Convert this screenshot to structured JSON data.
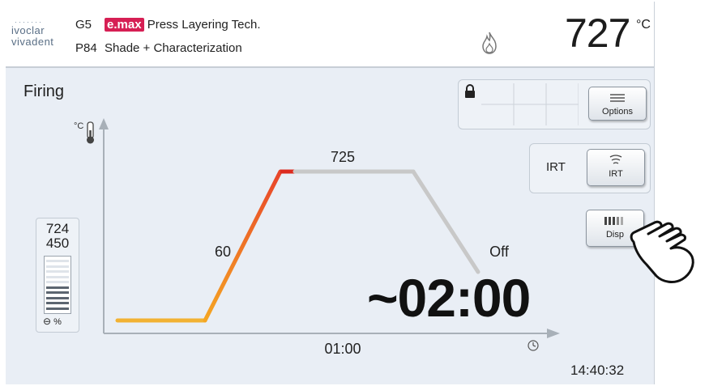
{
  "header": {
    "logo_line1": "ivoclar",
    "logo_line2": "vivadent",
    "program_code": "G5",
    "program_number": "P84",
    "brand": "e.max",
    "program_name": "Press Layering Tech.",
    "program_subtitle": "Shade + Characterization",
    "temperature": "727",
    "temperature_unit": "°C"
  },
  "screen": {
    "title": "Firing"
  },
  "gauge": {
    "value_top": "724",
    "value_bottom": "450",
    "fill_fraction": 0.5,
    "footer": "%"
  },
  "chart_data": {
    "type": "line",
    "title": "",
    "xlabel": "",
    "ylabel": "°C",
    "x_tick": "01:00",
    "segment_labels": {
      "rate": "60",
      "hold_temp": "725",
      "cooling": "Off"
    },
    "remaining_time": "~02:00"
  },
  "controls": {
    "options_label": "Options",
    "irt_text": "IRT",
    "irt_button_label": "IRT",
    "display_button_label": "Disp"
  },
  "footer": {
    "clock": "14:40:32"
  },
  "colors": {
    "brand": "#d61f54",
    "curve_start": "#f5a623",
    "curve_end": "#e8442a",
    "curve_future": "#c8c8c8",
    "background": "#e9eef5"
  }
}
